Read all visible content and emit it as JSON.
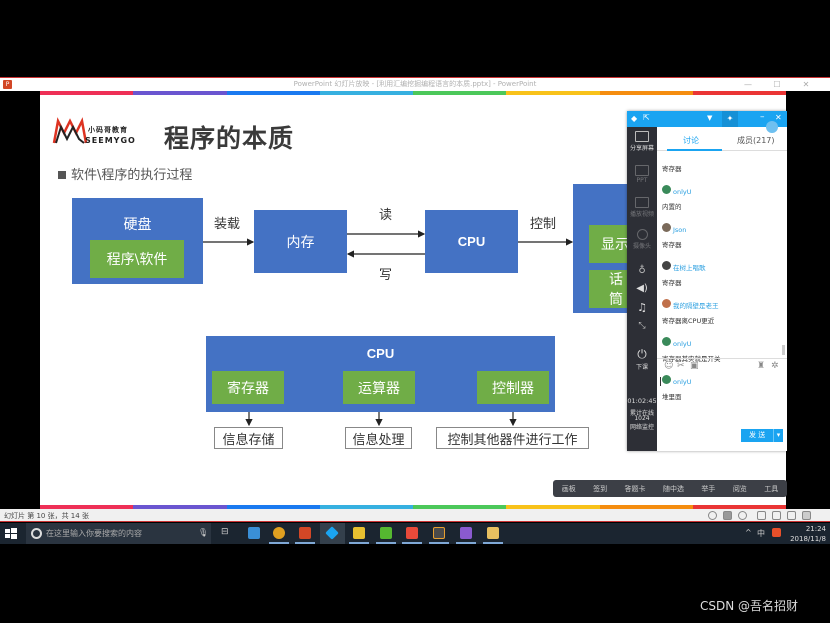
{
  "window": {
    "title": "PowerPoint 幻灯片放映 - [利用汇编挖掘编程语言的本质.pptx] - PowerPoint",
    "app_icon": "powerpoint-icon",
    "minimize": "—",
    "maximize": "☐",
    "close": "✕"
  },
  "rainbow_colors": [
    "#ee2f56",
    "#6a55d0",
    "#1a7af0",
    "#36b0e0",
    "#4cc85a",
    "#f8c21a",
    "#f58d0f",
    "#ea3535"
  ],
  "slide": {
    "logo_cn": "小码哥教育",
    "logo_en": "SEEMYGO",
    "title": "程序的本质",
    "bullet": "软件\\程序的执行过程",
    "disk": "硬盘",
    "program": "程序\\软件",
    "load": "装载",
    "memory": "内存",
    "read": "读",
    "write": "写",
    "cpu": "CPU",
    "control": "控制",
    "display": "显示",
    "speaker": "话筒",
    "cpu2": "CPU",
    "register": "寄存器",
    "alu": "运算器",
    "controller": "控制器",
    "info_storage": "信息存储",
    "info_processing": "信息处理",
    "control_others": "控制其他器件进行工作"
  },
  "statusbar": {
    "slide_count": "幻灯片 第 10 张，共 14 张"
  },
  "floatbar": {
    "items": [
      "画板",
      "签到",
      "答题卡",
      "随中选",
      "举手",
      "阅览",
      "工具"
    ]
  },
  "taskbar": {
    "search_placeholder": "在这里输入你要搜索的内容",
    "time": "21:24",
    "date": "2018/11/8",
    "ime": "中"
  },
  "chat": {
    "tabs": [
      "讨论",
      "成员(217)"
    ],
    "side": [
      "分享屏幕",
      "PPT",
      "播放视频",
      "摄像头",
      "下课"
    ],
    "timer": "01:02:45",
    "stats_label": "累计在线",
    "stats_value": "1024",
    "network": "网络监控",
    "messages": [
      {
        "name": "",
        "text": "寄存器"
      },
      {
        "name": "onlyU",
        "text": "内置的"
      },
      {
        "name": "Json",
        "text": "寄存器"
      },
      {
        "name": "在树上唱歌",
        "text": "寄存器"
      },
      {
        "name": "我的隔壁是老王",
        "text": "寄存器离CPU更近"
      },
      {
        "name": "onlyU",
        "text": "寄存器其实就是开关"
      },
      {
        "name": "onlyU",
        "text": "堆里面"
      }
    ],
    "send_label": "发 送",
    "send_dropdown": "▾"
  },
  "watermark": "CSDN @吾名招财"
}
